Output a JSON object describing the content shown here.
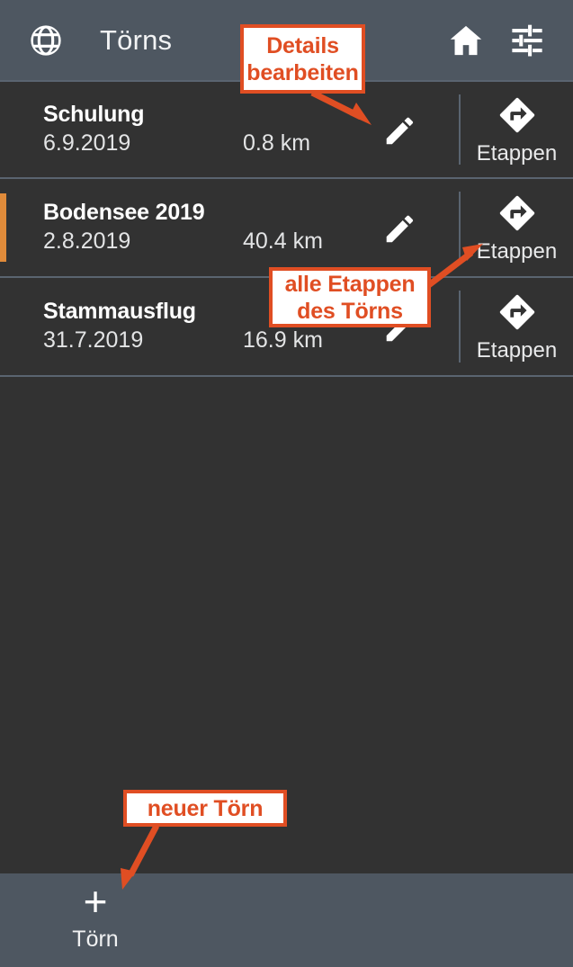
{
  "app": {
    "title": "Törns",
    "background_color": "#323232",
    "bar_color": "#4e5761",
    "accent_color": "#e08b3a",
    "annotation_color": "#e04e23"
  },
  "header": {
    "title": "Törns",
    "left_icon": "globe-icon",
    "right_icons": [
      "home-icon",
      "tune-icon"
    ]
  },
  "list": {
    "columns": [
      "name",
      "date",
      "distance"
    ],
    "rows": [
      {
        "name": "Schulung",
        "date": "6.9.2019",
        "distance": "0.8 km",
        "edit_icon": "pencil-icon",
        "stages_icon": "directions-icon",
        "stages_label": "Etappen",
        "selected": false
      },
      {
        "name": "Bodensee 2019",
        "date": "2.8.2019",
        "distance": "40.4 km",
        "edit_icon": "pencil-icon",
        "stages_icon": "directions-icon",
        "stages_label": "Etappen",
        "selected": true
      },
      {
        "name": "Stammausflug",
        "date": "31.7.2019",
        "distance": "16.9 km",
        "edit_icon": "pencil-icon",
        "stages_icon": "directions-icon",
        "stages_label": "Etappen",
        "selected": false
      }
    ]
  },
  "bottom_bar": {
    "add_icon": "plus-icon",
    "add_label": "Törn"
  },
  "annotations": [
    {
      "id": "details",
      "line1": "Details",
      "line2": "bearbeiten",
      "target": "row-edit-pencil"
    },
    {
      "id": "stages",
      "line1": "alle Etappen",
      "line2": "des Törns",
      "target": "row-stages-directions"
    },
    {
      "id": "new",
      "line1": "neuer Törn",
      "line2": "",
      "target": "bottom-add-button"
    }
  ]
}
